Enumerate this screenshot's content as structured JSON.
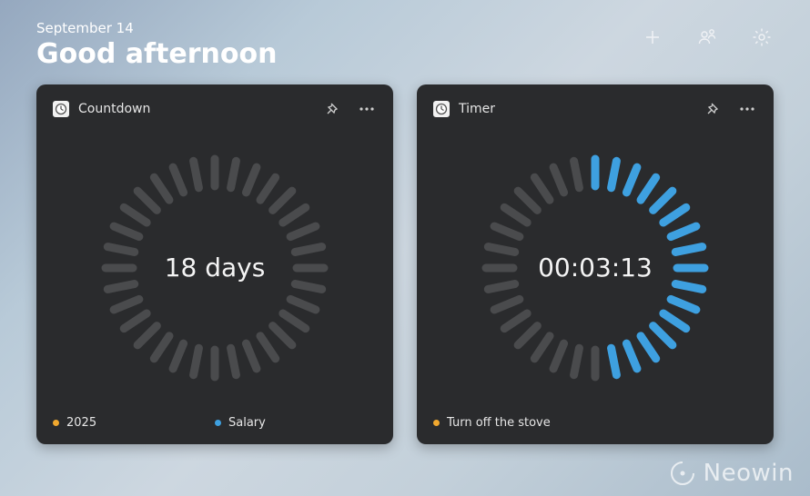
{
  "header": {
    "date": "September 14",
    "greeting": "Good afternoon"
  },
  "cards": [
    {
      "title": "Countdown",
      "center": "18 days",
      "legend": [
        {
          "label": "2025",
          "color": "#f0a82f"
        },
        {
          "label": "Salary",
          "color": "#3ea0e0"
        }
      ],
      "ticks_total": 32,
      "ticks_active": 0,
      "active_color": "#3ea0e0",
      "inactive_color": "#4a4b4d"
    },
    {
      "title": "Timer",
      "center": "00:03:13",
      "legend": [
        {
          "label": "Turn off the stove",
          "color": "#f0a82f"
        }
      ],
      "ticks_total": 32,
      "ticks_active": 16,
      "active_color": "#3ea0e0",
      "inactive_color": "#4a4b4d"
    }
  ],
  "watermark": "Neowin"
}
